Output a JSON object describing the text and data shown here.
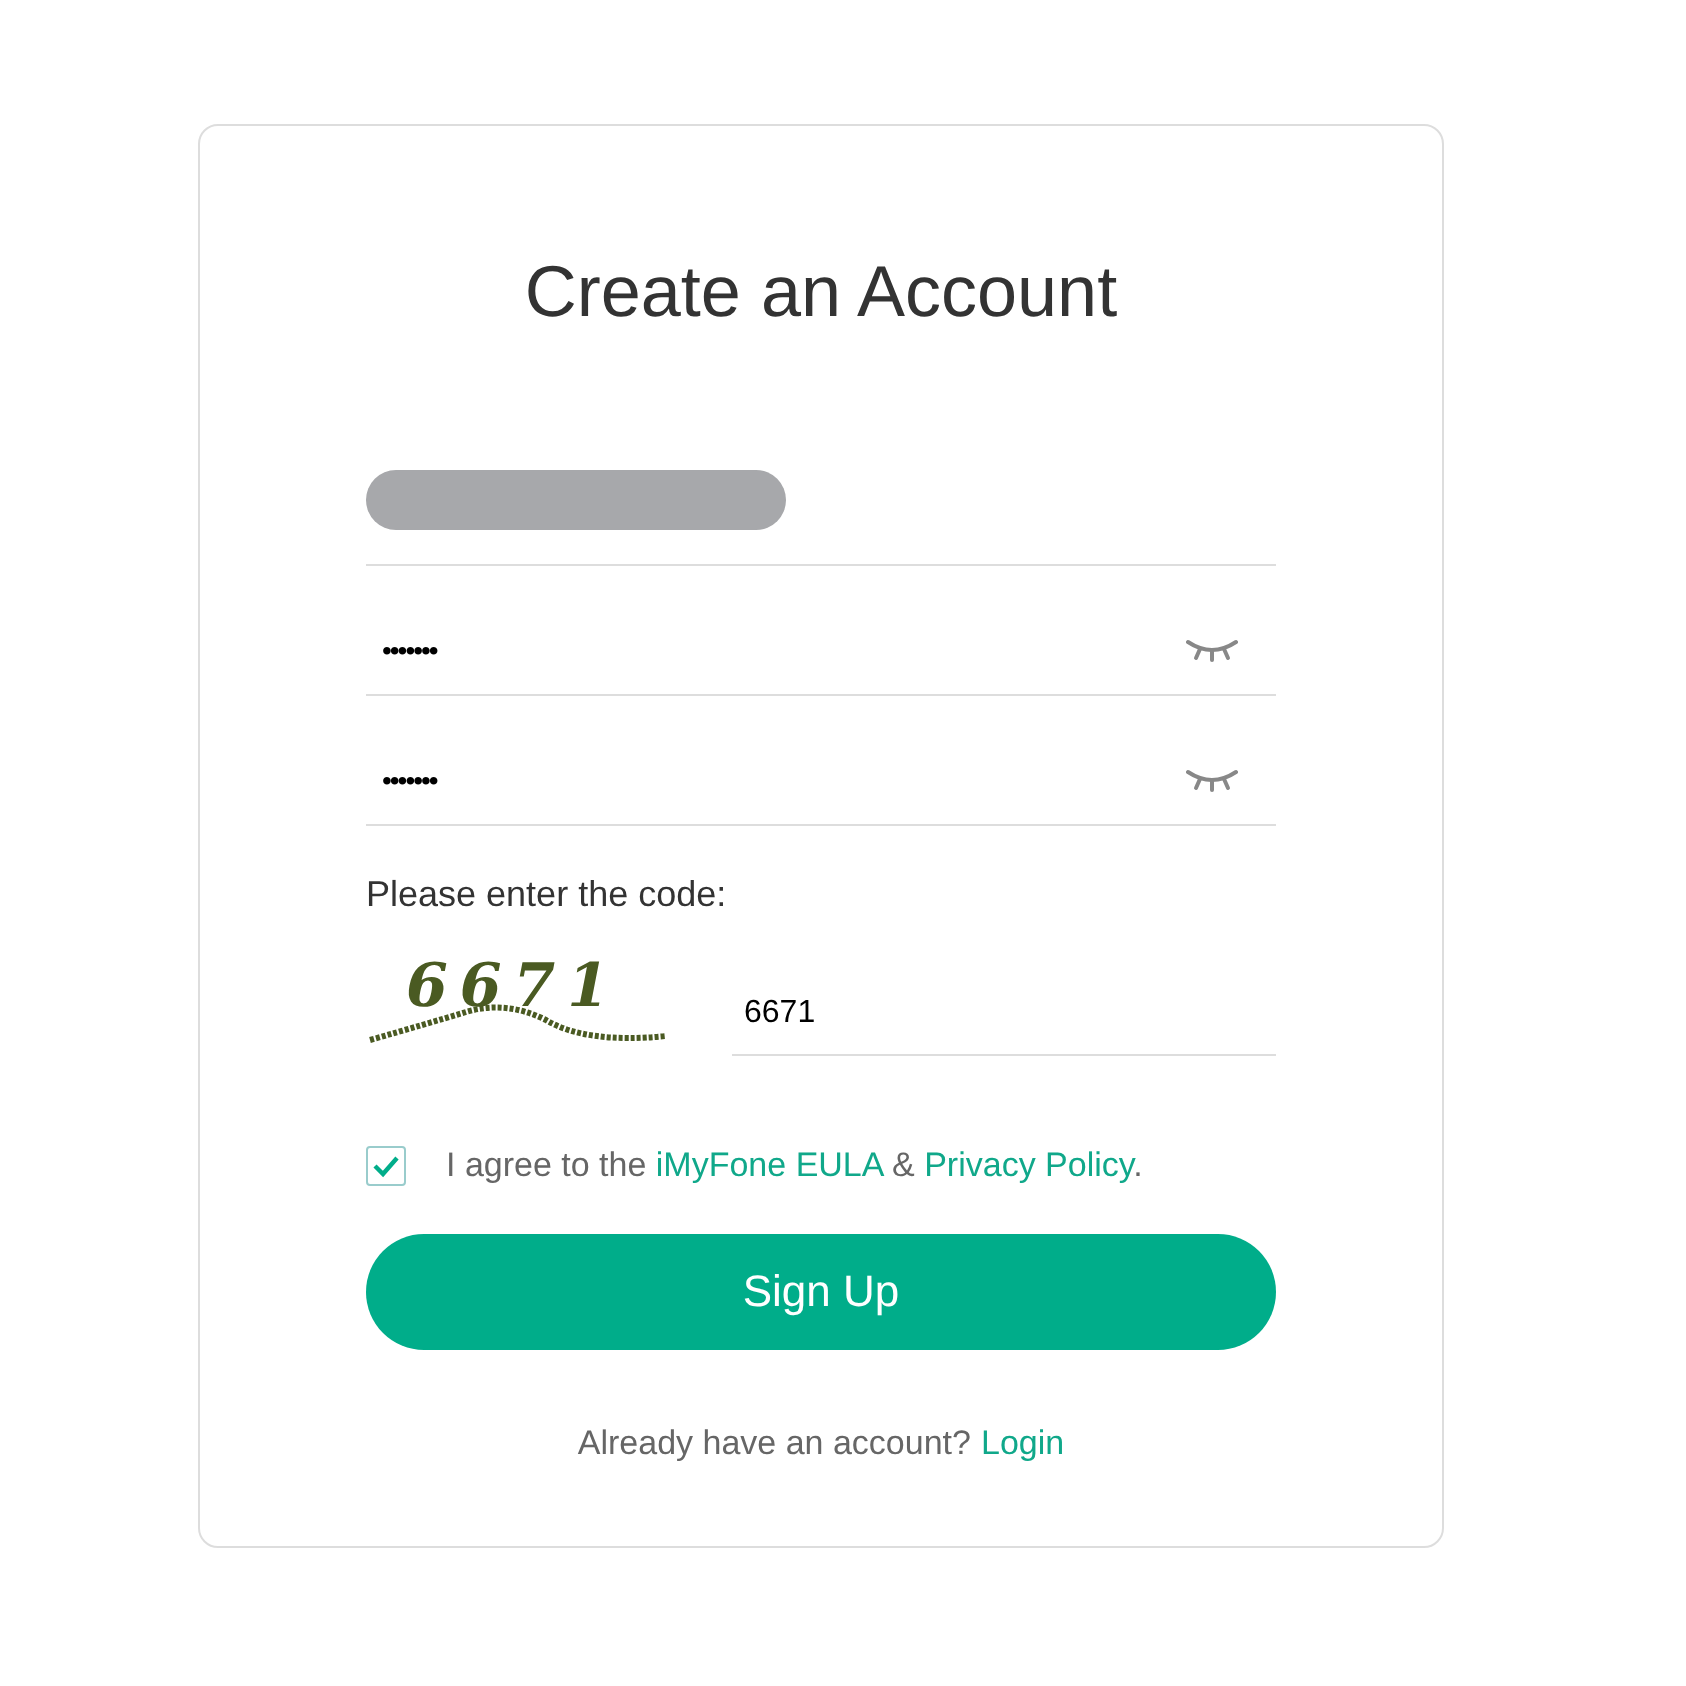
{
  "title": "Create an Account",
  "fields": [
    {
      "kind": "email",
      "redacted": true
    },
    {
      "kind": "password",
      "value": "•••••••"
    },
    {
      "kind": "password",
      "value": "•••••••"
    }
  ],
  "code_label": "Please enter the code:",
  "captcha": {
    "code": "6671"
  },
  "code_input": {
    "value": "6671"
  },
  "agreement": {
    "checked": true,
    "parts": [
      {
        "kind": "text",
        "text": "I agree to the "
      },
      {
        "kind": "link",
        "text": "iMyFone EULA"
      },
      {
        "kind": "text",
        "text": " & "
      },
      {
        "kind": "link",
        "text": "Privacy Policy"
      },
      {
        "kind": "text",
        "text": "."
      }
    ]
  },
  "submit": "Sign Up",
  "footer": {
    "text": "Already have an account?",
    "link": "Login"
  }
}
